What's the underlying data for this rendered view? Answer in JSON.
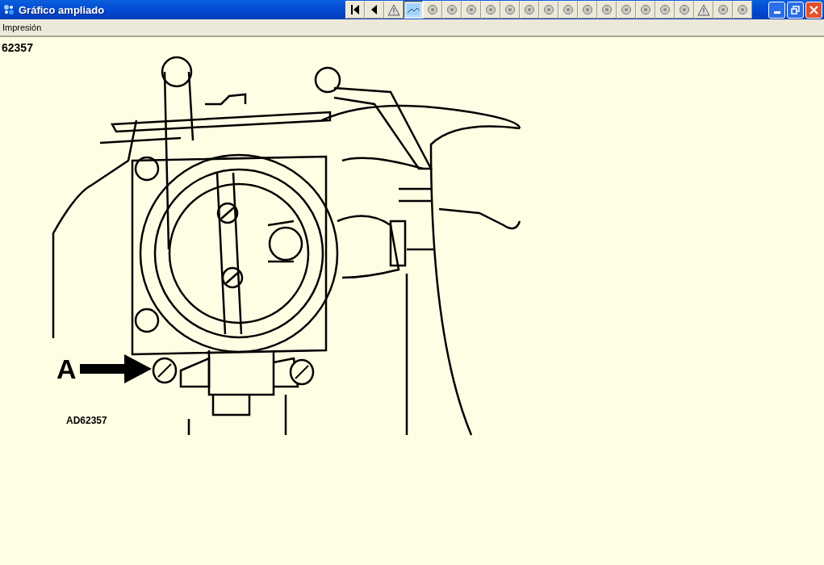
{
  "window": {
    "title": "Gráfico ampliado"
  },
  "toolbar": [
    {
      "kind": "first",
      "selected": false
    },
    {
      "kind": "prev",
      "selected": false
    },
    {
      "kind": "warning",
      "selected": false
    },
    {
      "kind": "image",
      "selected": true
    },
    {
      "kind": "part",
      "selected": false
    },
    {
      "kind": "part",
      "selected": false
    },
    {
      "kind": "part",
      "selected": false
    },
    {
      "kind": "part",
      "selected": false
    },
    {
      "kind": "part",
      "selected": false
    },
    {
      "kind": "part",
      "selected": false
    },
    {
      "kind": "part",
      "selected": false
    },
    {
      "kind": "part",
      "selected": false
    },
    {
      "kind": "part",
      "selected": false
    },
    {
      "kind": "part",
      "selected": false
    },
    {
      "kind": "part",
      "selected": false
    },
    {
      "kind": "part",
      "selected": false
    },
    {
      "kind": "part",
      "selected": false
    },
    {
      "kind": "part",
      "selected": false
    },
    {
      "kind": "warning",
      "selected": false
    },
    {
      "kind": "part",
      "selected": false
    },
    {
      "kind": "part",
      "selected": false
    }
  ],
  "menu": [
    "Impresión"
  ],
  "figure": {
    "number": "62357",
    "callout": "A",
    "code": "AD62357"
  }
}
